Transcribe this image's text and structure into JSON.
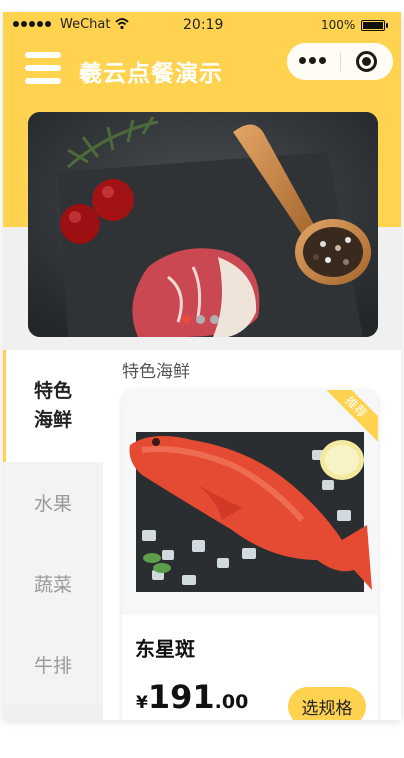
{
  "status_bar": {
    "carrier": "WeChat",
    "time": "20:19",
    "battery": "100%"
  },
  "nav": {
    "title": "羲云点餐演示",
    "icons": [
      "menu-icon",
      "more-icon",
      "close-capsule-icon"
    ]
  },
  "banner": {
    "slide_count": 3,
    "active_index": 0,
    "colors": {
      "dot_active": "#e94a3c",
      "dot_inactive": "#b0b0b0"
    }
  },
  "sidebar": {
    "items": [
      {
        "label": "特色\n海鲜",
        "active": true
      },
      {
        "label": "水果",
        "active": false
      },
      {
        "label": "蔬菜",
        "active": false
      },
      {
        "label": "牛排",
        "active": false
      }
    ]
  },
  "menu": {
    "section_title": "特色海鲜",
    "items": [
      {
        "ribbon": "推荐",
        "name": "东星斑",
        "price_currency": "¥",
        "price_int": "191",
        "price_dec": ".00",
        "button_label": "选规格"
      }
    ]
  },
  "colors": {
    "accent": "#ffd34f",
    "ribbon_text": "#ffffff"
  }
}
